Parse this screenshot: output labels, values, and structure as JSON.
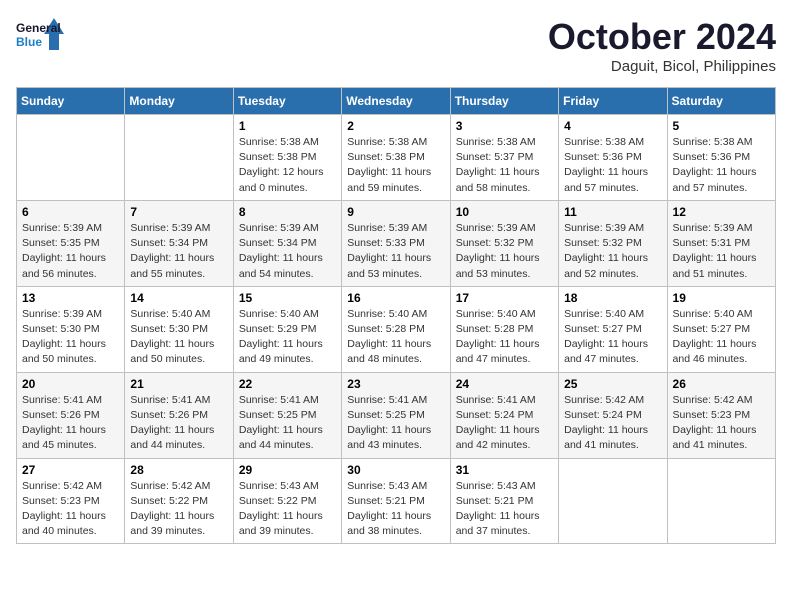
{
  "header": {
    "logo_general": "General",
    "logo_blue": "Blue",
    "month_title": "October 2024",
    "subtitle": "Daguit, Bicol, Philippines"
  },
  "weekdays": [
    "Sunday",
    "Monday",
    "Tuesday",
    "Wednesday",
    "Thursday",
    "Friday",
    "Saturday"
  ],
  "weeks": [
    [
      {
        "day": "",
        "info": ""
      },
      {
        "day": "",
        "info": ""
      },
      {
        "day": "1",
        "info": "Sunrise: 5:38 AM\nSunset: 5:38 PM\nDaylight: 12 hours and 0 minutes."
      },
      {
        "day": "2",
        "info": "Sunrise: 5:38 AM\nSunset: 5:38 PM\nDaylight: 11 hours and 59 minutes."
      },
      {
        "day": "3",
        "info": "Sunrise: 5:38 AM\nSunset: 5:37 PM\nDaylight: 11 hours and 58 minutes."
      },
      {
        "day": "4",
        "info": "Sunrise: 5:38 AM\nSunset: 5:36 PM\nDaylight: 11 hours and 57 minutes."
      },
      {
        "day": "5",
        "info": "Sunrise: 5:38 AM\nSunset: 5:36 PM\nDaylight: 11 hours and 57 minutes."
      }
    ],
    [
      {
        "day": "6",
        "info": "Sunrise: 5:39 AM\nSunset: 5:35 PM\nDaylight: 11 hours and 56 minutes."
      },
      {
        "day": "7",
        "info": "Sunrise: 5:39 AM\nSunset: 5:34 PM\nDaylight: 11 hours and 55 minutes."
      },
      {
        "day": "8",
        "info": "Sunrise: 5:39 AM\nSunset: 5:34 PM\nDaylight: 11 hours and 54 minutes."
      },
      {
        "day": "9",
        "info": "Sunrise: 5:39 AM\nSunset: 5:33 PM\nDaylight: 11 hours and 53 minutes."
      },
      {
        "day": "10",
        "info": "Sunrise: 5:39 AM\nSunset: 5:32 PM\nDaylight: 11 hours and 53 minutes."
      },
      {
        "day": "11",
        "info": "Sunrise: 5:39 AM\nSunset: 5:32 PM\nDaylight: 11 hours and 52 minutes."
      },
      {
        "day": "12",
        "info": "Sunrise: 5:39 AM\nSunset: 5:31 PM\nDaylight: 11 hours and 51 minutes."
      }
    ],
    [
      {
        "day": "13",
        "info": "Sunrise: 5:39 AM\nSunset: 5:30 PM\nDaylight: 11 hours and 50 minutes."
      },
      {
        "day": "14",
        "info": "Sunrise: 5:40 AM\nSunset: 5:30 PM\nDaylight: 11 hours and 50 minutes."
      },
      {
        "day": "15",
        "info": "Sunrise: 5:40 AM\nSunset: 5:29 PM\nDaylight: 11 hours and 49 minutes."
      },
      {
        "day": "16",
        "info": "Sunrise: 5:40 AM\nSunset: 5:28 PM\nDaylight: 11 hours and 48 minutes."
      },
      {
        "day": "17",
        "info": "Sunrise: 5:40 AM\nSunset: 5:28 PM\nDaylight: 11 hours and 47 minutes."
      },
      {
        "day": "18",
        "info": "Sunrise: 5:40 AM\nSunset: 5:27 PM\nDaylight: 11 hours and 47 minutes."
      },
      {
        "day": "19",
        "info": "Sunrise: 5:40 AM\nSunset: 5:27 PM\nDaylight: 11 hours and 46 minutes."
      }
    ],
    [
      {
        "day": "20",
        "info": "Sunrise: 5:41 AM\nSunset: 5:26 PM\nDaylight: 11 hours and 45 minutes."
      },
      {
        "day": "21",
        "info": "Sunrise: 5:41 AM\nSunset: 5:26 PM\nDaylight: 11 hours and 44 minutes."
      },
      {
        "day": "22",
        "info": "Sunrise: 5:41 AM\nSunset: 5:25 PM\nDaylight: 11 hours and 44 minutes."
      },
      {
        "day": "23",
        "info": "Sunrise: 5:41 AM\nSunset: 5:25 PM\nDaylight: 11 hours and 43 minutes."
      },
      {
        "day": "24",
        "info": "Sunrise: 5:41 AM\nSunset: 5:24 PM\nDaylight: 11 hours and 42 minutes."
      },
      {
        "day": "25",
        "info": "Sunrise: 5:42 AM\nSunset: 5:24 PM\nDaylight: 11 hours and 41 minutes."
      },
      {
        "day": "26",
        "info": "Sunrise: 5:42 AM\nSunset: 5:23 PM\nDaylight: 11 hours and 41 minutes."
      }
    ],
    [
      {
        "day": "27",
        "info": "Sunrise: 5:42 AM\nSunset: 5:23 PM\nDaylight: 11 hours and 40 minutes."
      },
      {
        "day": "28",
        "info": "Sunrise: 5:42 AM\nSunset: 5:22 PM\nDaylight: 11 hours and 39 minutes."
      },
      {
        "day": "29",
        "info": "Sunrise: 5:43 AM\nSunset: 5:22 PM\nDaylight: 11 hours and 39 minutes."
      },
      {
        "day": "30",
        "info": "Sunrise: 5:43 AM\nSunset: 5:21 PM\nDaylight: 11 hours and 38 minutes."
      },
      {
        "day": "31",
        "info": "Sunrise: 5:43 AM\nSunset: 5:21 PM\nDaylight: 11 hours and 37 minutes."
      },
      {
        "day": "",
        "info": ""
      },
      {
        "day": "",
        "info": ""
      }
    ]
  ]
}
